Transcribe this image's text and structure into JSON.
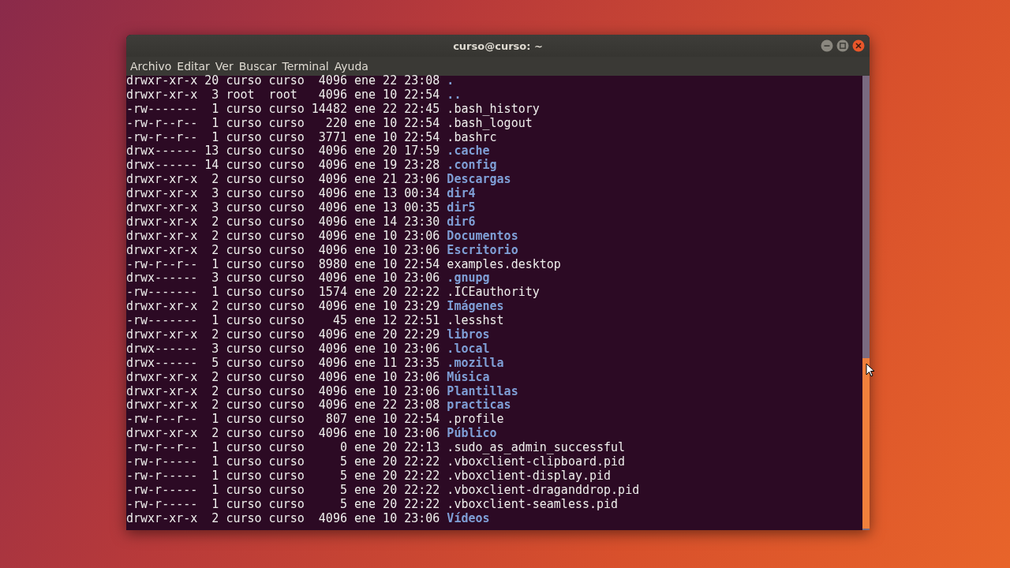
{
  "window": {
    "title": "curso@curso: ~"
  },
  "menu": [
    "Archivo",
    "Editar",
    "Ver",
    "Buscar",
    "Terminal",
    "Ayuda"
  ],
  "listing": [
    {
      "info": "drwxr-xr-x 20 curso curso  4096 ene 22 23:08",
      "name": ".",
      "kind": "dir"
    },
    {
      "info": "drwxr-xr-x  3 root  root   4096 ene 10 22:54",
      "name": "..",
      "kind": "dir"
    },
    {
      "info": "-rw-------  1 curso curso 14482 ene 22 22:45",
      "name": ".bash_history",
      "kind": "file"
    },
    {
      "info": "-rw-r--r--  1 curso curso   220 ene 10 22:54",
      "name": ".bash_logout",
      "kind": "file"
    },
    {
      "info": "-rw-r--r--  1 curso curso  3771 ene 10 22:54",
      "name": ".bashrc",
      "kind": "file"
    },
    {
      "info": "drwx------ 13 curso curso  4096 ene 20 17:59",
      "name": ".cache",
      "kind": "dir"
    },
    {
      "info": "drwx------ 14 curso curso  4096 ene 19 23:28",
      "name": ".config",
      "kind": "dir"
    },
    {
      "info": "drwxr-xr-x  2 curso curso  4096 ene 21 23:06",
      "name": "Descargas",
      "kind": "dir"
    },
    {
      "info": "drwxr-xr-x  3 curso curso  4096 ene 13 00:34",
      "name": "dir4",
      "kind": "dir"
    },
    {
      "info": "drwxr-xr-x  3 curso curso  4096 ene 13 00:35",
      "name": "dir5",
      "kind": "dir"
    },
    {
      "info": "drwxr-xr-x  2 curso curso  4096 ene 14 23:30",
      "name": "dir6",
      "kind": "dir"
    },
    {
      "info": "drwxr-xr-x  2 curso curso  4096 ene 10 23:06",
      "name": "Documentos",
      "kind": "dir"
    },
    {
      "info": "drwxr-xr-x  2 curso curso  4096 ene 10 23:06",
      "name": "Escritorio",
      "kind": "dir"
    },
    {
      "info": "-rw-r--r--  1 curso curso  8980 ene 10 22:54",
      "name": "examples.desktop",
      "kind": "file"
    },
    {
      "info": "drwx------  3 curso curso  4096 ene 10 23:06",
      "name": ".gnupg",
      "kind": "dir"
    },
    {
      "info": "-rw-------  1 curso curso  1574 ene 20 22:22",
      "name": ".ICEauthority",
      "kind": "file"
    },
    {
      "info": "drwxr-xr-x  2 curso curso  4096 ene 10 23:29",
      "name": "Imágenes",
      "kind": "dir"
    },
    {
      "info": "-rw-------  1 curso curso    45 ene 12 22:51",
      "name": ".lesshst",
      "kind": "file"
    },
    {
      "info": "drwxr-xr-x  2 curso curso  4096 ene 20 22:29",
      "name": "libros",
      "kind": "dir"
    },
    {
      "info": "drwx------  3 curso curso  4096 ene 10 23:06",
      "name": ".local",
      "kind": "dir"
    },
    {
      "info": "drwx------  5 curso curso  4096 ene 11 23:35",
      "name": ".mozilla",
      "kind": "dir"
    },
    {
      "info": "drwxr-xr-x  2 curso curso  4096 ene 10 23:06",
      "name": "Música",
      "kind": "dir"
    },
    {
      "info": "drwxr-xr-x  2 curso curso  4096 ene 10 23:06",
      "name": "Plantillas",
      "kind": "dir"
    },
    {
      "info": "drwxr-xr-x  2 curso curso  4096 ene 22 23:08",
      "name": "practicas",
      "kind": "dir"
    },
    {
      "info": "-rw-r--r--  1 curso curso   807 ene 10 22:54",
      "name": ".profile",
      "kind": "file"
    },
    {
      "info": "drwxr-xr-x  2 curso curso  4096 ene 10 23:06",
      "name": "Público",
      "kind": "dir"
    },
    {
      "info": "-rw-r--r--  1 curso curso     0 ene 20 22:13",
      "name": ".sudo_as_admin_successful",
      "kind": "file"
    },
    {
      "info": "-rw-r-----  1 curso curso     5 ene 20 22:22",
      "name": ".vboxclient-clipboard.pid",
      "kind": "file"
    },
    {
      "info": "-rw-r-----  1 curso curso     5 ene 20 22:22",
      "name": ".vboxclient-display.pid",
      "kind": "file"
    },
    {
      "info": "-rw-r-----  1 curso curso     5 ene 20 22:22",
      "name": ".vboxclient-draganddrop.pid",
      "kind": "file"
    },
    {
      "info": "-rw-r-----  1 curso curso     5 ene 20 22:22",
      "name": ".vboxclient-seamless.pid",
      "kind": "file"
    },
    {
      "info": "drwxr-xr-x  2 curso curso  4096 ene 10 23:06",
      "name": "Vídeos",
      "kind": "dir"
    }
  ]
}
